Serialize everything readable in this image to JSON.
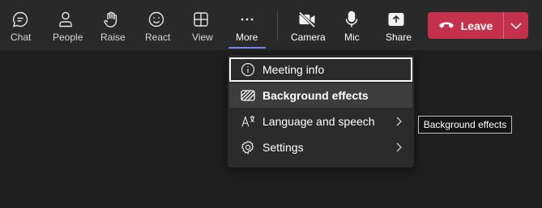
{
  "toolbar": {
    "chat": {
      "label": "Chat",
      "icon": "chat-icon"
    },
    "people": {
      "label": "People",
      "icon": "people-icon"
    },
    "raise": {
      "label": "Raise",
      "icon": "raise-hand-icon"
    },
    "react": {
      "label": "React",
      "icon": "react-smiley-icon"
    },
    "view": {
      "label": "View",
      "icon": "view-grid-icon"
    },
    "more": {
      "label": "More",
      "icon": "more-ellipsis-icon"
    },
    "camera": {
      "label": "Camera",
      "icon": "camera-off-icon"
    },
    "mic": {
      "label": "Mic",
      "icon": "mic-icon"
    },
    "share": {
      "label": "Share",
      "icon": "share-icon"
    },
    "leave": {
      "label": "Leave",
      "icon": "phone-hangup-icon"
    }
  },
  "more_menu": {
    "items": [
      {
        "label": "Meeting info",
        "icon": "info-icon",
        "state": "focused"
      },
      {
        "label": "Background effects",
        "icon": "background-effects-icon",
        "state": "hovered"
      },
      {
        "label": "Language and speech",
        "icon": "language-icon",
        "has_submenu": true
      },
      {
        "label": "Settings",
        "icon": "settings-gear-icon",
        "has_submenu": true
      }
    ]
  },
  "tooltip": {
    "text": "Background effects"
  },
  "colors": {
    "toolbar_bg": "#292929",
    "stage_bg": "#1f1f1f",
    "leave_red": "#c4314b",
    "accent_underline": "#7f85f5",
    "menu_bg": "#2b2b2b",
    "menu_hover": "#3d3d3d"
  }
}
